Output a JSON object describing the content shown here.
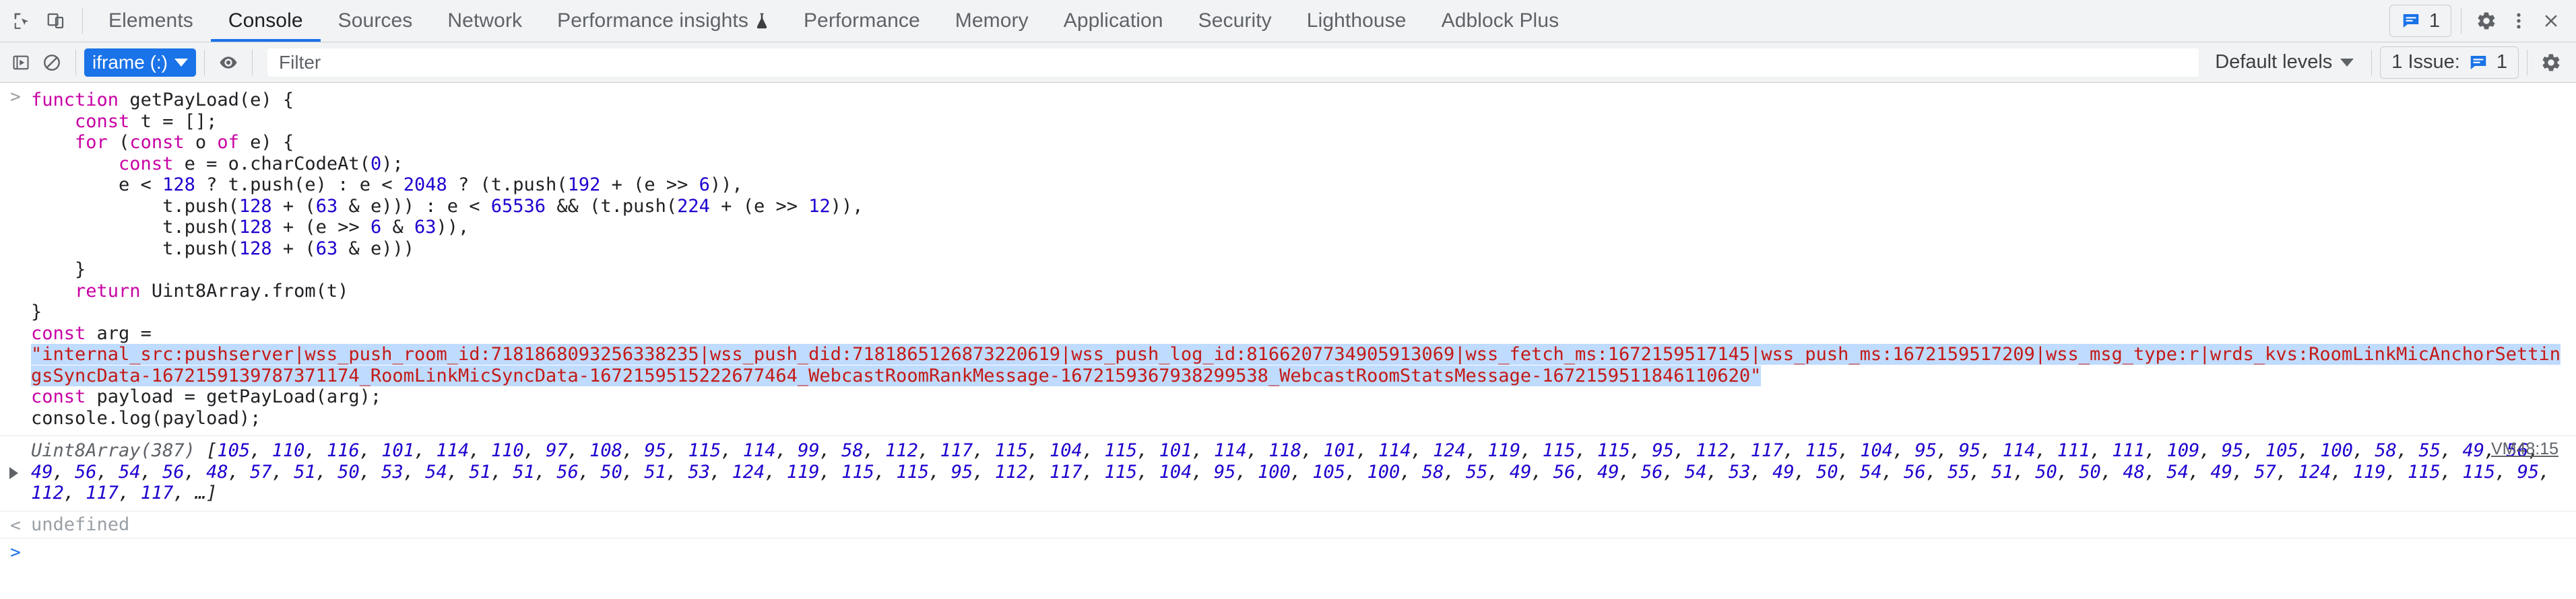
{
  "tabbar": {
    "left_icons": [
      {
        "name": "inspect-element-icon",
        "title": "Inspect"
      },
      {
        "name": "device-toolbar-icon",
        "title": "Toggle device toolbar"
      }
    ],
    "tabs": [
      {
        "label": "Elements",
        "active": false,
        "icon": null
      },
      {
        "label": "Console",
        "active": true,
        "icon": null
      },
      {
        "label": "Sources",
        "active": false,
        "icon": null
      },
      {
        "label": "Network",
        "active": false,
        "icon": null
      },
      {
        "label": "Performance insights",
        "active": false,
        "icon": "flask-icon"
      },
      {
        "label": "Performance",
        "active": false,
        "icon": null
      },
      {
        "label": "Memory",
        "active": false,
        "icon": null
      },
      {
        "label": "Application",
        "active": false,
        "icon": null
      },
      {
        "label": "Security",
        "active": false,
        "icon": null
      },
      {
        "label": "Lighthouse",
        "active": false,
        "icon": null
      },
      {
        "label": "Adblock Plus",
        "active": false,
        "icon": null
      }
    ],
    "issue_count": "1",
    "right_icons": [
      "settings-gear-icon",
      "more-options-icon",
      "close-icon"
    ],
    "accent": "#1a73e8"
  },
  "console_toolbar": {
    "execute_icon": "execution-context-icon",
    "clear_label": "clear-console-icon",
    "context": "iframe (:)",
    "eye_icon": "live-expression-eye-icon",
    "filter_placeholder": "Filter",
    "filter_value": "",
    "levels": "Default levels",
    "issues_label": "1 Issue:",
    "issues_count": "1",
    "settings_icon": "console-settings-gear-icon"
  },
  "console": {
    "input_prompt": ">",
    "output_prompt": "<",
    "source_link": "VM48:15",
    "code_lines": [
      [
        {
          "t": "kw",
          "v": "function "
        },
        {
          "t": "plain",
          "v": "getPayLoad(e) {"
        }
      ],
      [
        {
          "t": "plain",
          "v": "    "
        },
        {
          "t": "kw",
          "v": "const "
        },
        {
          "t": "plain",
          "v": "t = [];"
        }
      ],
      [
        {
          "t": "plain",
          "v": "    "
        },
        {
          "t": "kw",
          "v": "for "
        },
        {
          "t": "plain",
          "v": "("
        },
        {
          "t": "kw",
          "v": "const "
        },
        {
          "t": "plain",
          "v": "o "
        },
        {
          "t": "kw",
          "v": "of "
        },
        {
          "t": "plain",
          "v": "e) {"
        }
      ],
      [
        {
          "t": "plain",
          "v": "        "
        },
        {
          "t": "kw",
          "v": "const "
        },
        {
          "t": "plain",
          "v": "e = o.charCodeAt("
        },
        {
          "t": "num",
          "v": "0"
        },
        {
          "t": "plain",
          "v": ");"
        }
      ],
      [
        {
          "t": "plain",
          "v": "        e < "
        },
        {
          "t": "num",
          "v": "128"
        },
        {
          "t": "plain",
          "v": " ? t.push(e) : e < "
        },
        {
          "t": "num",
          "v": "2048"
        },
        {
          "t": "plain",
          "v": " ? (t.push("
        },
        {
          "t": "num",
          "v": "192"
        },
        {
          "t": "plain",
          "v": " + (e >> "
        },
        {
          "t": "num",
          "v": "6"
        },
        {
          "t": "plain",
          "v": ")),"
        }
      ],
      [
        {
          "t": "plain",
          "v": "            t.push("
        },
        {
          "t": "num",
          "v": "128"
        },
        {
          "t": "plain",
          "v": " + ("
        },
        {
          "t": "num",
          "v": "63"
        },
        {
          "t": "plain",
          "v": " & e))) : e < "
        },
        {
          "t": "num",
          "v": "65536"
        },
        {
          "t": "plain",
          "v": " && (t.push("
        },
        {
          "t": "num",
          "v": "224"
        },
        {
          "t": "plain",
          "v": " + (e >> "
        },
        {
          "t": "num",
          "v": "12"
        },
        {
          "t": "plain",
          "v": ")),"
        }
      ],
      [
        {
          "t": "plain",
          "v": "            t.push("
        },
        {
          "t": "num",
          "v": "128"
        },
        {
          "t": "plain",
          "v": " + (e >> "
        },
        {
          "t": "num",
          "v": "6"
        },
        {
          "t": "plain",
          "v": " & "
        },
        {
          "t": "num",
          "v": "63"
        },
        {
          "t": "plain",
          "v": ")),"
        }
      ],
      [
        {
          "t": "plain",
          "v": "            t.push("
        },
        {
          "t": "num",
          "v": "128"
        },
        {
          "t": "plain",
          "v": " + ("
        },
        {
          "t": "num",
          "v": "63"
        },
        {
          "t": "plain",
          "v": " & e)))"
        }
      ],
      [
        {
          "t": "plain",
          "v": "    }"
        }
      ],
      [
        {
          "t": "plain",
          "v": "    "
        },
        {
          "t": "kw",
          "v": "return "
        },
        {
          "t": "plain",
          "v": "Uint8Array.from(t)"
        }
      ],
      [
        {
          "t": "plain",
          "v": "}"
        }
      ],
      [
        {
          "t": "plain",
          "v": ""
        }
      ],
      [
        {
          "t": "kw",
          "v": "const "
        },
        {
          "t": "plain",
          "v": "arg ="
        }
      ],
      [
        {
          "t": "str",
          "v": "\"internal_src:pushserver|wss_push_room_id:7181868093256338235|wss_push_did:7181865126873220619|wss_push_log_id:8166207734905913069|wss_fetch_ms:1672159517145|wss_push_ms:1672159517209|wss_msg_type:r|wrds_kvs:RoomLinkMicAnchorSettingsSyncData-1672159139787371174_RoomLinkMicSyncData-1672159515222677464_WebcastRoomRankMessage-1672159367938299538_WebcastRoomStatsMessage-1672159511846110620\""
        }
      ],
      [
        {
          "t": "kw",
          "v": "const "
        },
        {
          "t": "plain",
          "v": "payload = getPayLoad(arg);"
        }
      ],
      [
        {
          "t": "plain",
          "v": "console.log(payload);"
        }
      ]
    ],
    "output_type": "Uint8Array(387)",
    "output_values": [
      105,
      110,
      116,
      101,
      114,
      110,
      97,
      108,
      95,
      115,
      114,
      99,
      58,
      112,
      117,
      115,
      104,
      115,
      101,
      114,
      118,
      101,
      114,
      124,
      119,
      115,
      115,
      95,
      112,
      117,
      115,
      104,
      95,
      95,
      114,
      111,
      111,
      109,
      95,
      105,
      100,
      58,
      55,
      49,
      56,
      49,
      56,
      54,
      56,
      48,
      57,
      51,
      50,
      53,
      54,
      51,
      51,
      56,
      50,
      51,
      53,
      124,
      119,
      115,
      115,
      95,
      112,
      117,
      115,
      104,
      95,
      100,
      105,
      100,
      58,
      55,
      49,
      56,
      49,
      56,
      54,
      53,
      49,
      50,
      54,
      56,
      55,
      51,
      50,
      50,
      48,
      54,
      49,
      57,
      124,
      119,
      115,
      115,
      95,
      112,
      117,
      117
    ],
    "output_truncated": "…",
    "undefined_text": "undefined"
  }
}
